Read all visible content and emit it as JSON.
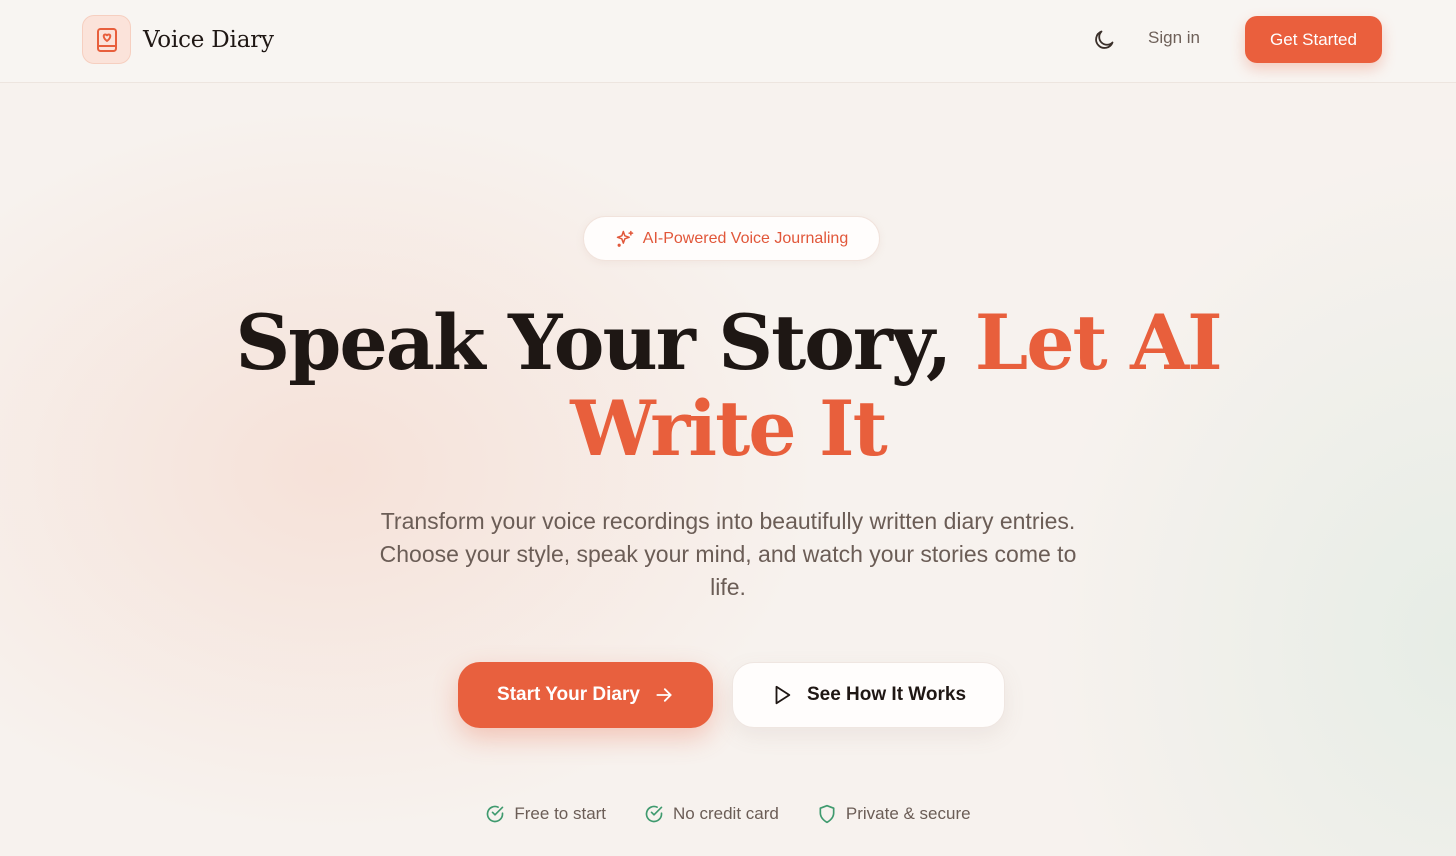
{
  "header": {
    "logo_text": "Voice Diary",
    "logo_icon": "diary-heart-icon",
    "theme_toggle_icon": "moon-icon",
    "sign_in_label": "Sign in",
    "get_started_label": "Get Started"
  },
  "hero": {
    "badge_icon": "sparkles-icon",
    "badge_text": "AI-Powered Voice Journaling",
    "headline_main": "Speak Your Story, ",
    "headline_accent": "Let AI Write It",
    "subtitle": "Transform your voice recordings into beautifully written diary entries. Choose your style, speak your mind, and watch your stories come to life.",
    "primary_button_label": "Start Your Diary",
    "primary_button_icon": "arrow-right-icon",
    "secondary_button_label": "See How It Works",
    "secondary_button_icon": "play-icon"
  },
  "features": [
    {
      "icon": "check-circle-icon",
      "label": "Free to start"
    },
    {
      "icon": "check-circle-icon",
      "label": "No credit card"
    },
    {
      "icon": "shield-icon",
      "label": "Private & secure"
    }
  ],
  "colors": {
    "accent": "#e8603e",
    "feature_icon": "#3f9a6e",
    "background": "#f7f2ee"
  }
}
